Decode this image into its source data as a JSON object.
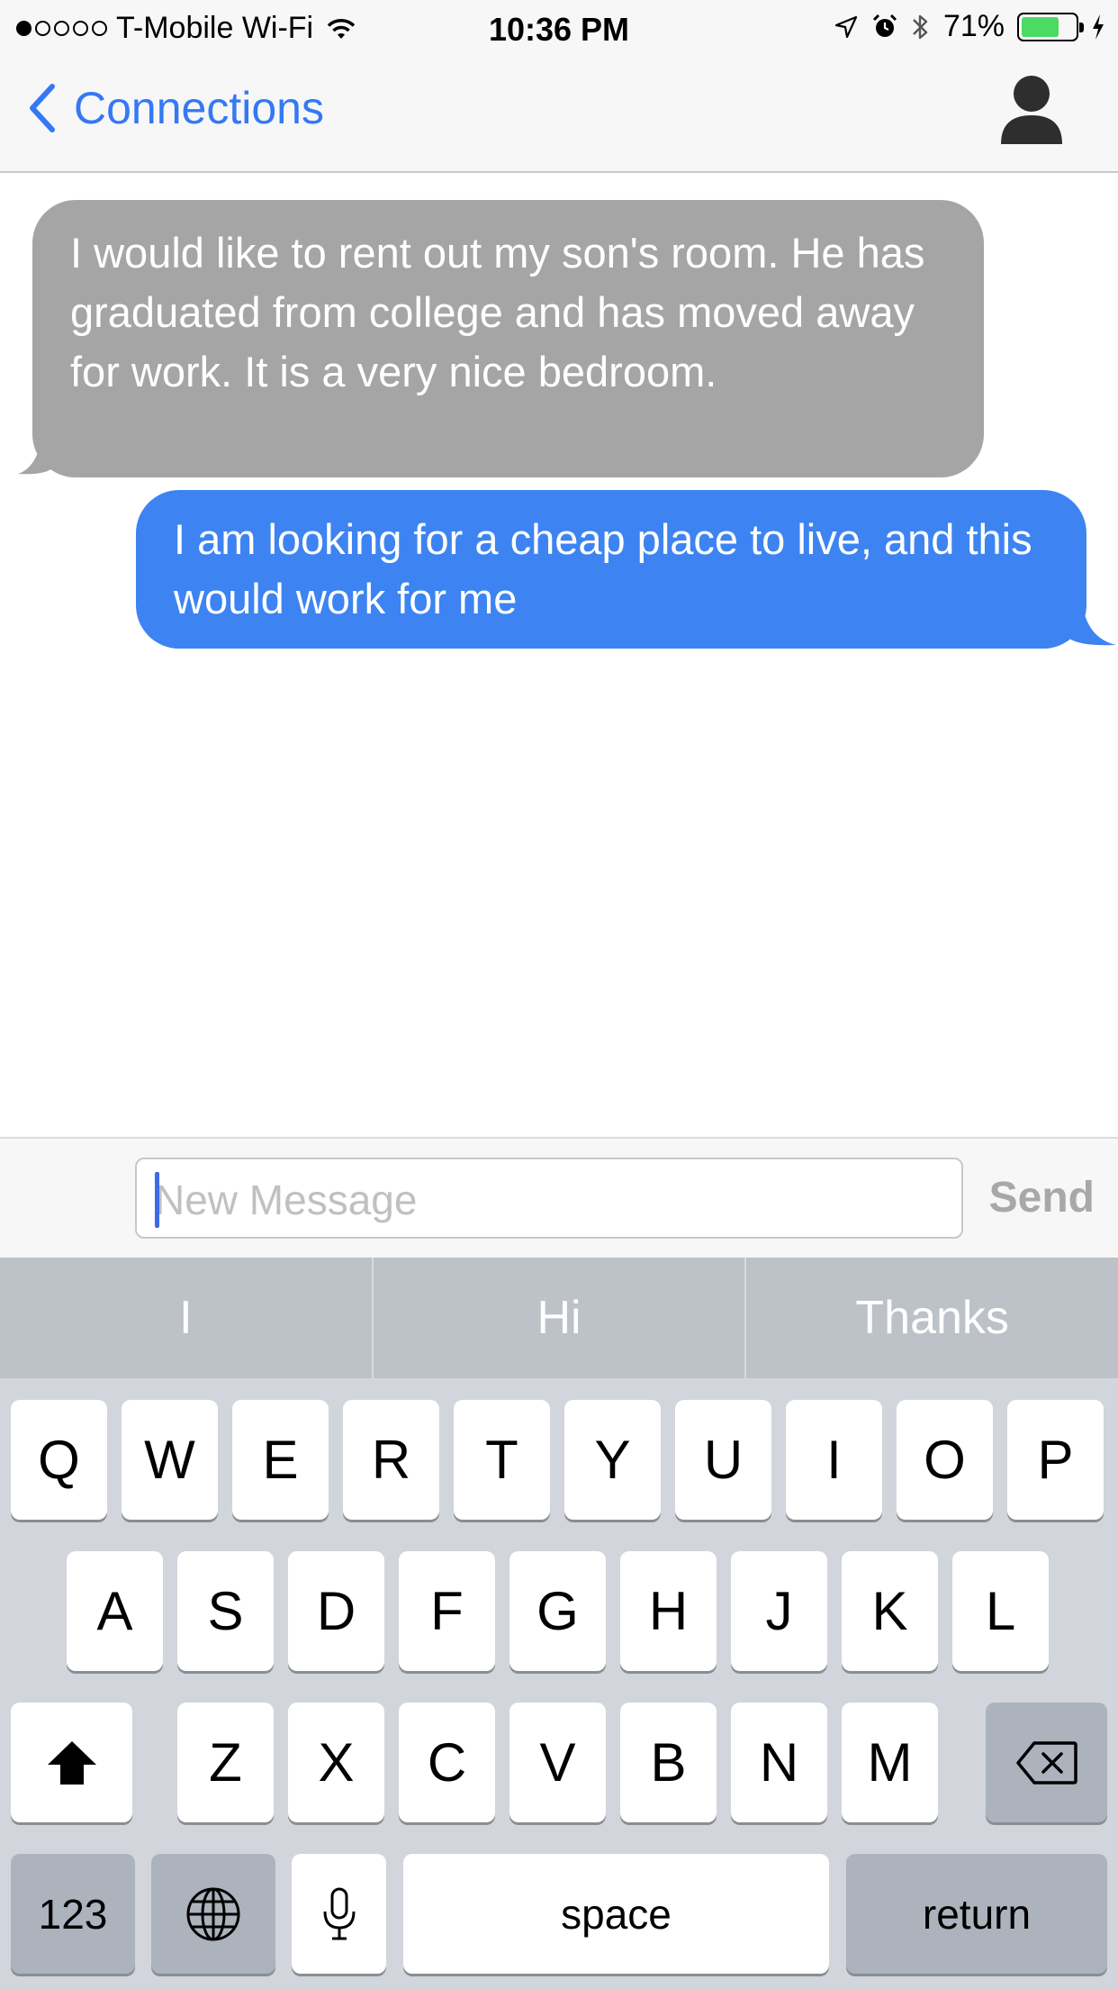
{
  "status_bar": {
    "carrier": "T-Mobile Wi-Fi",
    "time": "10:36 PM",
    "battery_percent": "71%",
    "battery_level": 0.71,
    "icons": [
      "signal-dots-icon",
      "wifi-icon",
      "location-icon",
      "alarm-icon",
      "bluetooth-icon",
      "battery-icon",
      "charging-icon"
    ]
  },
  "nav": {
    "back_label": "Connections",
    "avatar_icon": "person-icon"
  },
  "messages": [
    {
      "direction": "incoming",
      "text": "I would like to rent out my son's room.  He has graduated from college and has moved away for work.  It is a very nice bedroom."
    },
    {
      "direction": "outgoing",
      "text": "I am looking for a cheap place to live, and this would work for me"
    }
  ],
  "composer": {
    "placeholder": "New Message",
    "send_label": "Send"
  },
  "keyboard": {
    "suggestions": [
      "I",
      "Hi",
      "Thanks"
    ],
    "rows": [
      [
        "Q",
        "W",
        "E",
        "R",
        "T",
        "Y",
        "U",
        "I",
        "O",
        "P"
      ],
      [
        "A",
        "S",
        "D",
        "F",
        "G",
        "H",
        "J",
        "K",
        "L"
      ],
      [
        "Z",
        "X",
        "C",
        "V",
        "B",
        "N",
        "M"
      ]
    ],
    "numbers_label": "123",
    "space_label": "space",
    "return_label": "return"
  },
  "colors": {
    "accent": "#3478f6",
    "outgoing_bubble": "#3d84f2",
    "incoming_bubble": "#a5a5a5",
    "battery": "#4cd964"
  }
}
